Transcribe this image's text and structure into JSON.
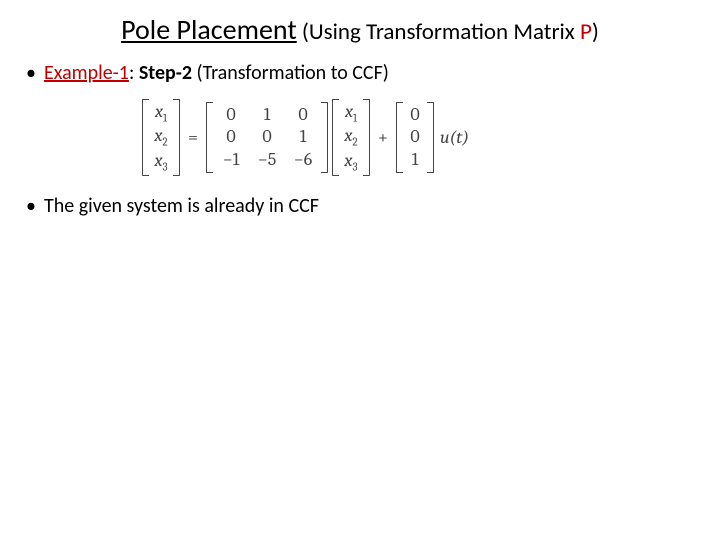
{
  "title": {
    "main": "Pole Placement",
    "sub_open": " (",
    "sub_text": "Using Transformation Matrix ",
    "sub_var": "P",
    "sub_close": ")"
  },
  "bullet1": {
    "example_label": "Example-1",
    "colon": ": ",
    "step_label": "Step-2",
    "rest": " (Transformation to CCF)"
  },
  "equation": {
    "lhs_vector": [
      "x1",
      "x2",
      "x3"
    ],
    "A": [
      [
        "0",
        "1",
        "0"
      ],
      [
        "0",
        "0",
        "1"
      ],
      [
        "−1",
        "−5",
        "−6"
      ]
    ],
    "x_vector": [
      "x1",
      "x2",
      "x3"
    ],
    "B": [
      "0",
      "0",
      "1"
    ],
    "u": "u(t)",
    "eq_sign": "=",
    "plus_sign": "+"
  },
  "bullet2": "The given system is already in CCF"
}
